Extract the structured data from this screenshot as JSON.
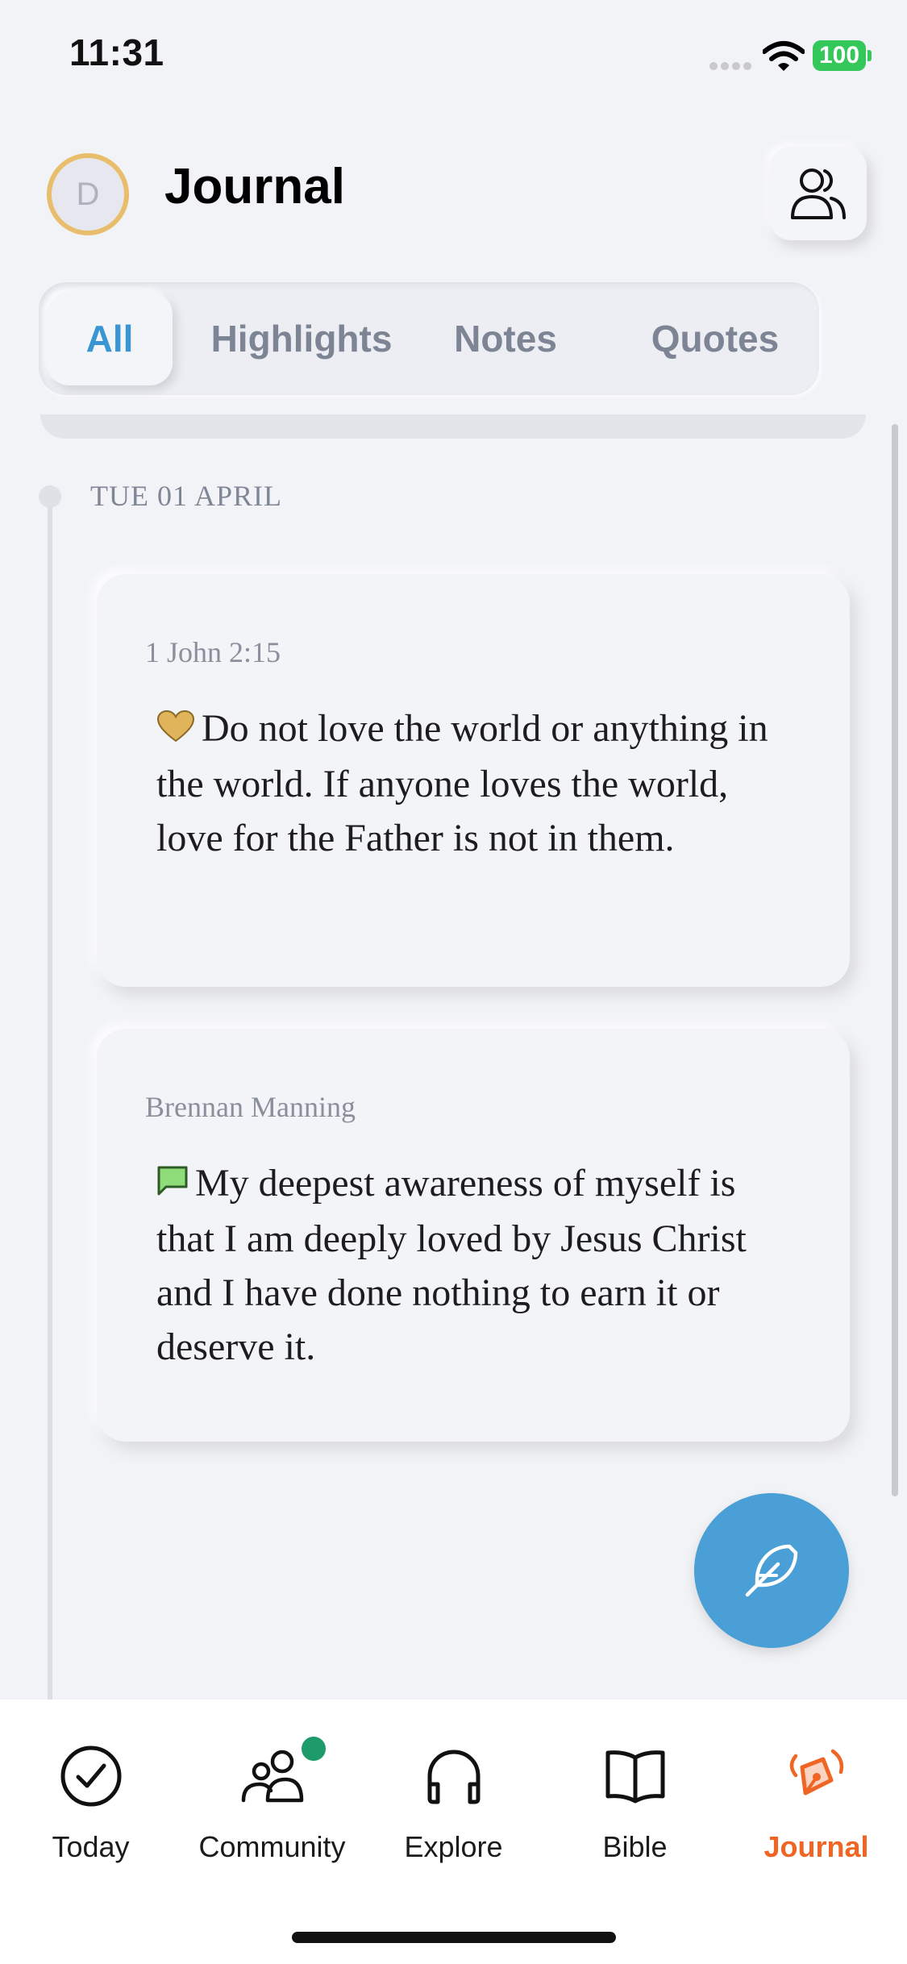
{
  "status_bar": {
    "time": "11:31",
    "battery": "100"
  },
  "header": {
    "avatar_initial": "D",
    "title": "Journal"
  },
  "tabs": [
    {
      "label": "All",
      "active": true
    },
    {
      "label": "Highlights",
      "active": false
    },
    {
      "label": "Notes",
      "active": false
    },
    {
      "label": "Quotes",
      "active": false
    }
  ],
  "timeline": {
    "date": "TUE 01 APRIL",
    "entries": [
      {
        "reference": "1 John 2:15",
        "type_icon": "heart-icon",
        "icon_color": "#e0b45a",
        "text": "Do not love the world or anything in the world. If anyone loves the world, love for the Father is not in them."
      },
      {
        "reference": "Brennan Manning",
        "type_icon": "quote-bubble-icon",
        "icon_color": "#8fdc7a",
        "text": "My deepest awareness of myself is that I am deeply loved by Jesus Christ and I have done nothing to earn it or deserve it."
      }
    ]
  },
  "bottom_nav": [
    {
      "label": "Today",
      "icon": "check-circle-icon",
      "active": false
    },
    {
      "label": "Community",
      "icon": "people-icon",
      "active": false,
      "badge": true
    },
    {
      "label": "Explore",
      "icon": "headphones-icon",
      "active": false
    },
    {
      "label": "Bible",
      "icon": "book-icon",
      "active": false
    },
    {
      "label": "Journal",
      "icon": "pen-nib-icon",
      "active": true
    }
  ],
  "colors": {
    "accent_blue": "#3a95d3",
    "accent_orange": "#f06424",
    "fab": "#4a9fd6"
  }
}
